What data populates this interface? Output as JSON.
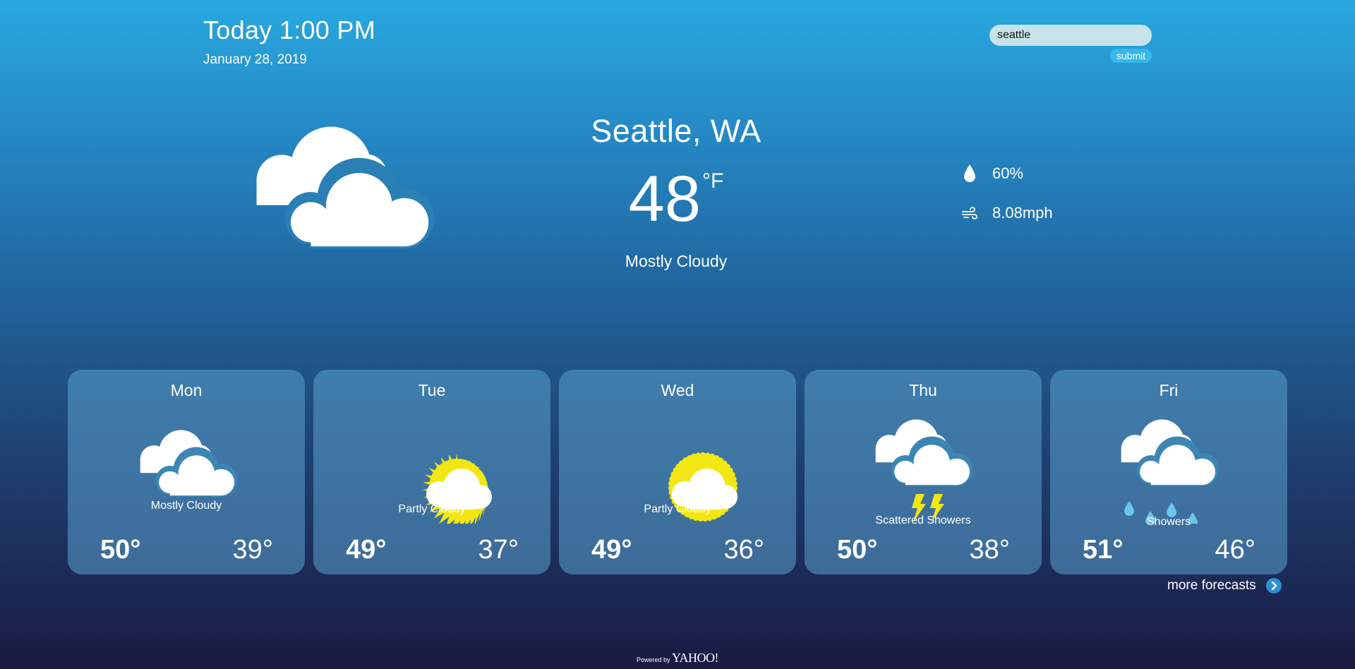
{
  "header": {
    "time": "Today 1:00 PM",
    "date": "January 28, 2019"
  },
  "search": {
    "value": "seattle",
    "submit_label": "submit"
  },
  "current": {
    "city": "Seattle, WA",
    "temperature": "48",
    "unit": "°F",
    "condition": "Mostly Cloudy",
    "icon": "mostly-cloudy-icon",
    "humidity": "60%",
    "humidity_icon": "water-drop-icon",
    "wind": "8.08mph",
    "wind_icon": "wind-icon"
  },
  "forecast": [
    {
      "day": "Mon",
      "condition": "Mostly Cloudy",
      "high": "50°",
      "low": "39°",
      "icon": "mostly-cloudy-icon"
    },
    {
      "day": "Tue",
      "condition": "Partly Cloudy",
      "high": "49°",
      "low": "37°",
      "icon": "partly-cloudy-icon"
    },
    {
      "day": "Wed",
      "condition": "Partly Cloudy",
      "high": "49°",
      "low": "36°",
      "icon": "partly-cloudy-icon"
    },
    {
      "day": "Thu",
      "condition": "Scattered Showers",
      "high": "50°",
      "low": "38°",
      "icon": "thunderstorm-icon"
    },
    {
      "day": "Fri",
      "condition": "Showers",
      "high": "51°",
      "low": "46°",
      "icon": "rain-showers-icon"
    }
  ],
  "more_forecasts_label": "more forecasts",
  "footer": {
    "powered_by": "Powered by",
    "brand": "YAHOO!"
  },
  "colors": {
    "sun": "#f3e713",
    "rain": "#6cc5ee",
    "lightning": "#f3e713",
    "card": "#4f95c4",
    "search_bg": "#c6e3ea",
    "submit_bg": "#36b8ea"
  }
}
